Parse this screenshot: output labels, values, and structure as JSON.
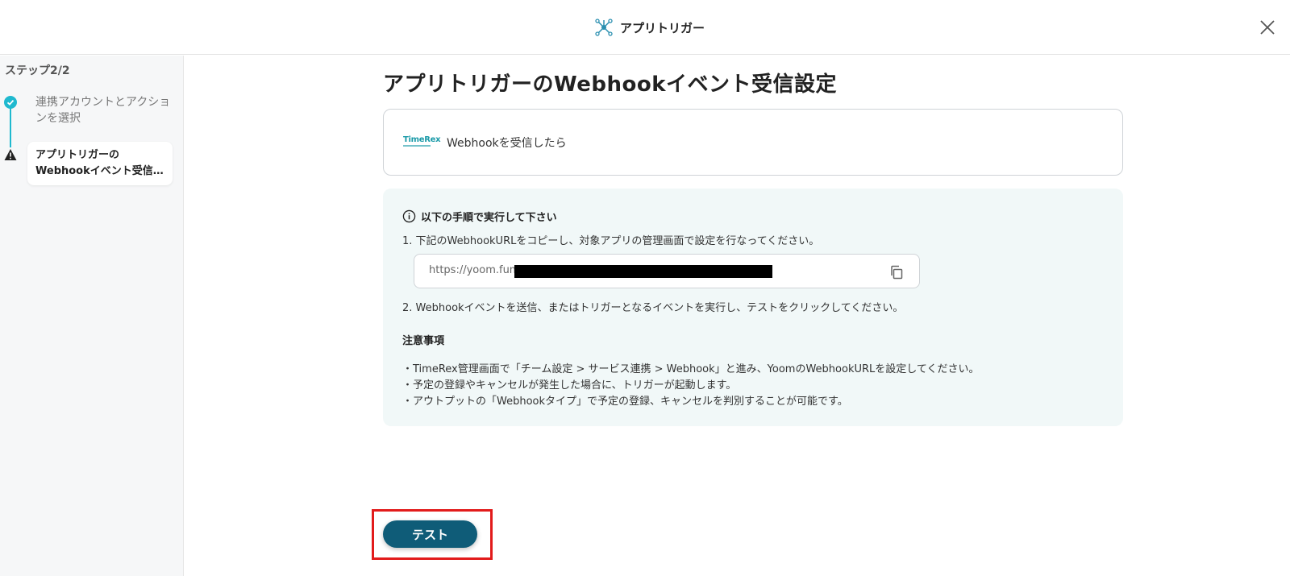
{
  "header": {
    "title": "アプリトリガー"
  },
  "sidebar": {
    "step_label": "ステップ2/2",
    "steps": [
      {
        "label": "連携アカウントとアクションを選択",
        "status": "done"
      },
      {
        "line1": "アプリトリガーの",
        "line2": "Webhookイベント受信...",
        "status": "warning"
      }
    ]
  },
  "main": {
    "title": "アプリトリガーのWebhookイベント受信設定",
    "app_card": {
      "logo_text": "TimeRex",
      "text": "Webhookを受信したら"
    },
    "instructions": {
      "heading": "以下の手順で実行して下さい",
      "step1": "1. 下記のWebhookURLをコピーし、対象アプリの管理画面で設定を行なってください。",
      "url_prefix": "https://yoom.fun/",
      "step2": "2. Webhookイベントを送信、またはトリガーとなるイベントを実行し、テストをクリックしてください。",
      "notes_heading": "注意事項",
      "notes": [
        "・TimeRex管理画面で「チーム設定 > サービス連携 > Webhook」と進み、YoomのWebhookURLを設定してください。",
        "・予定の登録やキャンセルが発生した場合に、トリガーが起動します。",
        "・アウトプットの「Webhookタイプ」で予定の登録、キャンセルを判別することが可能です。"
      ]
    },
    "test_button": "テスト"
  },
  "colors": {
    "accent": "#1fb9cf",
    "button": "#0f5c78",
    "highlight": "#e21b1b",
    "panel": "#f1f8f8"
  }
}
